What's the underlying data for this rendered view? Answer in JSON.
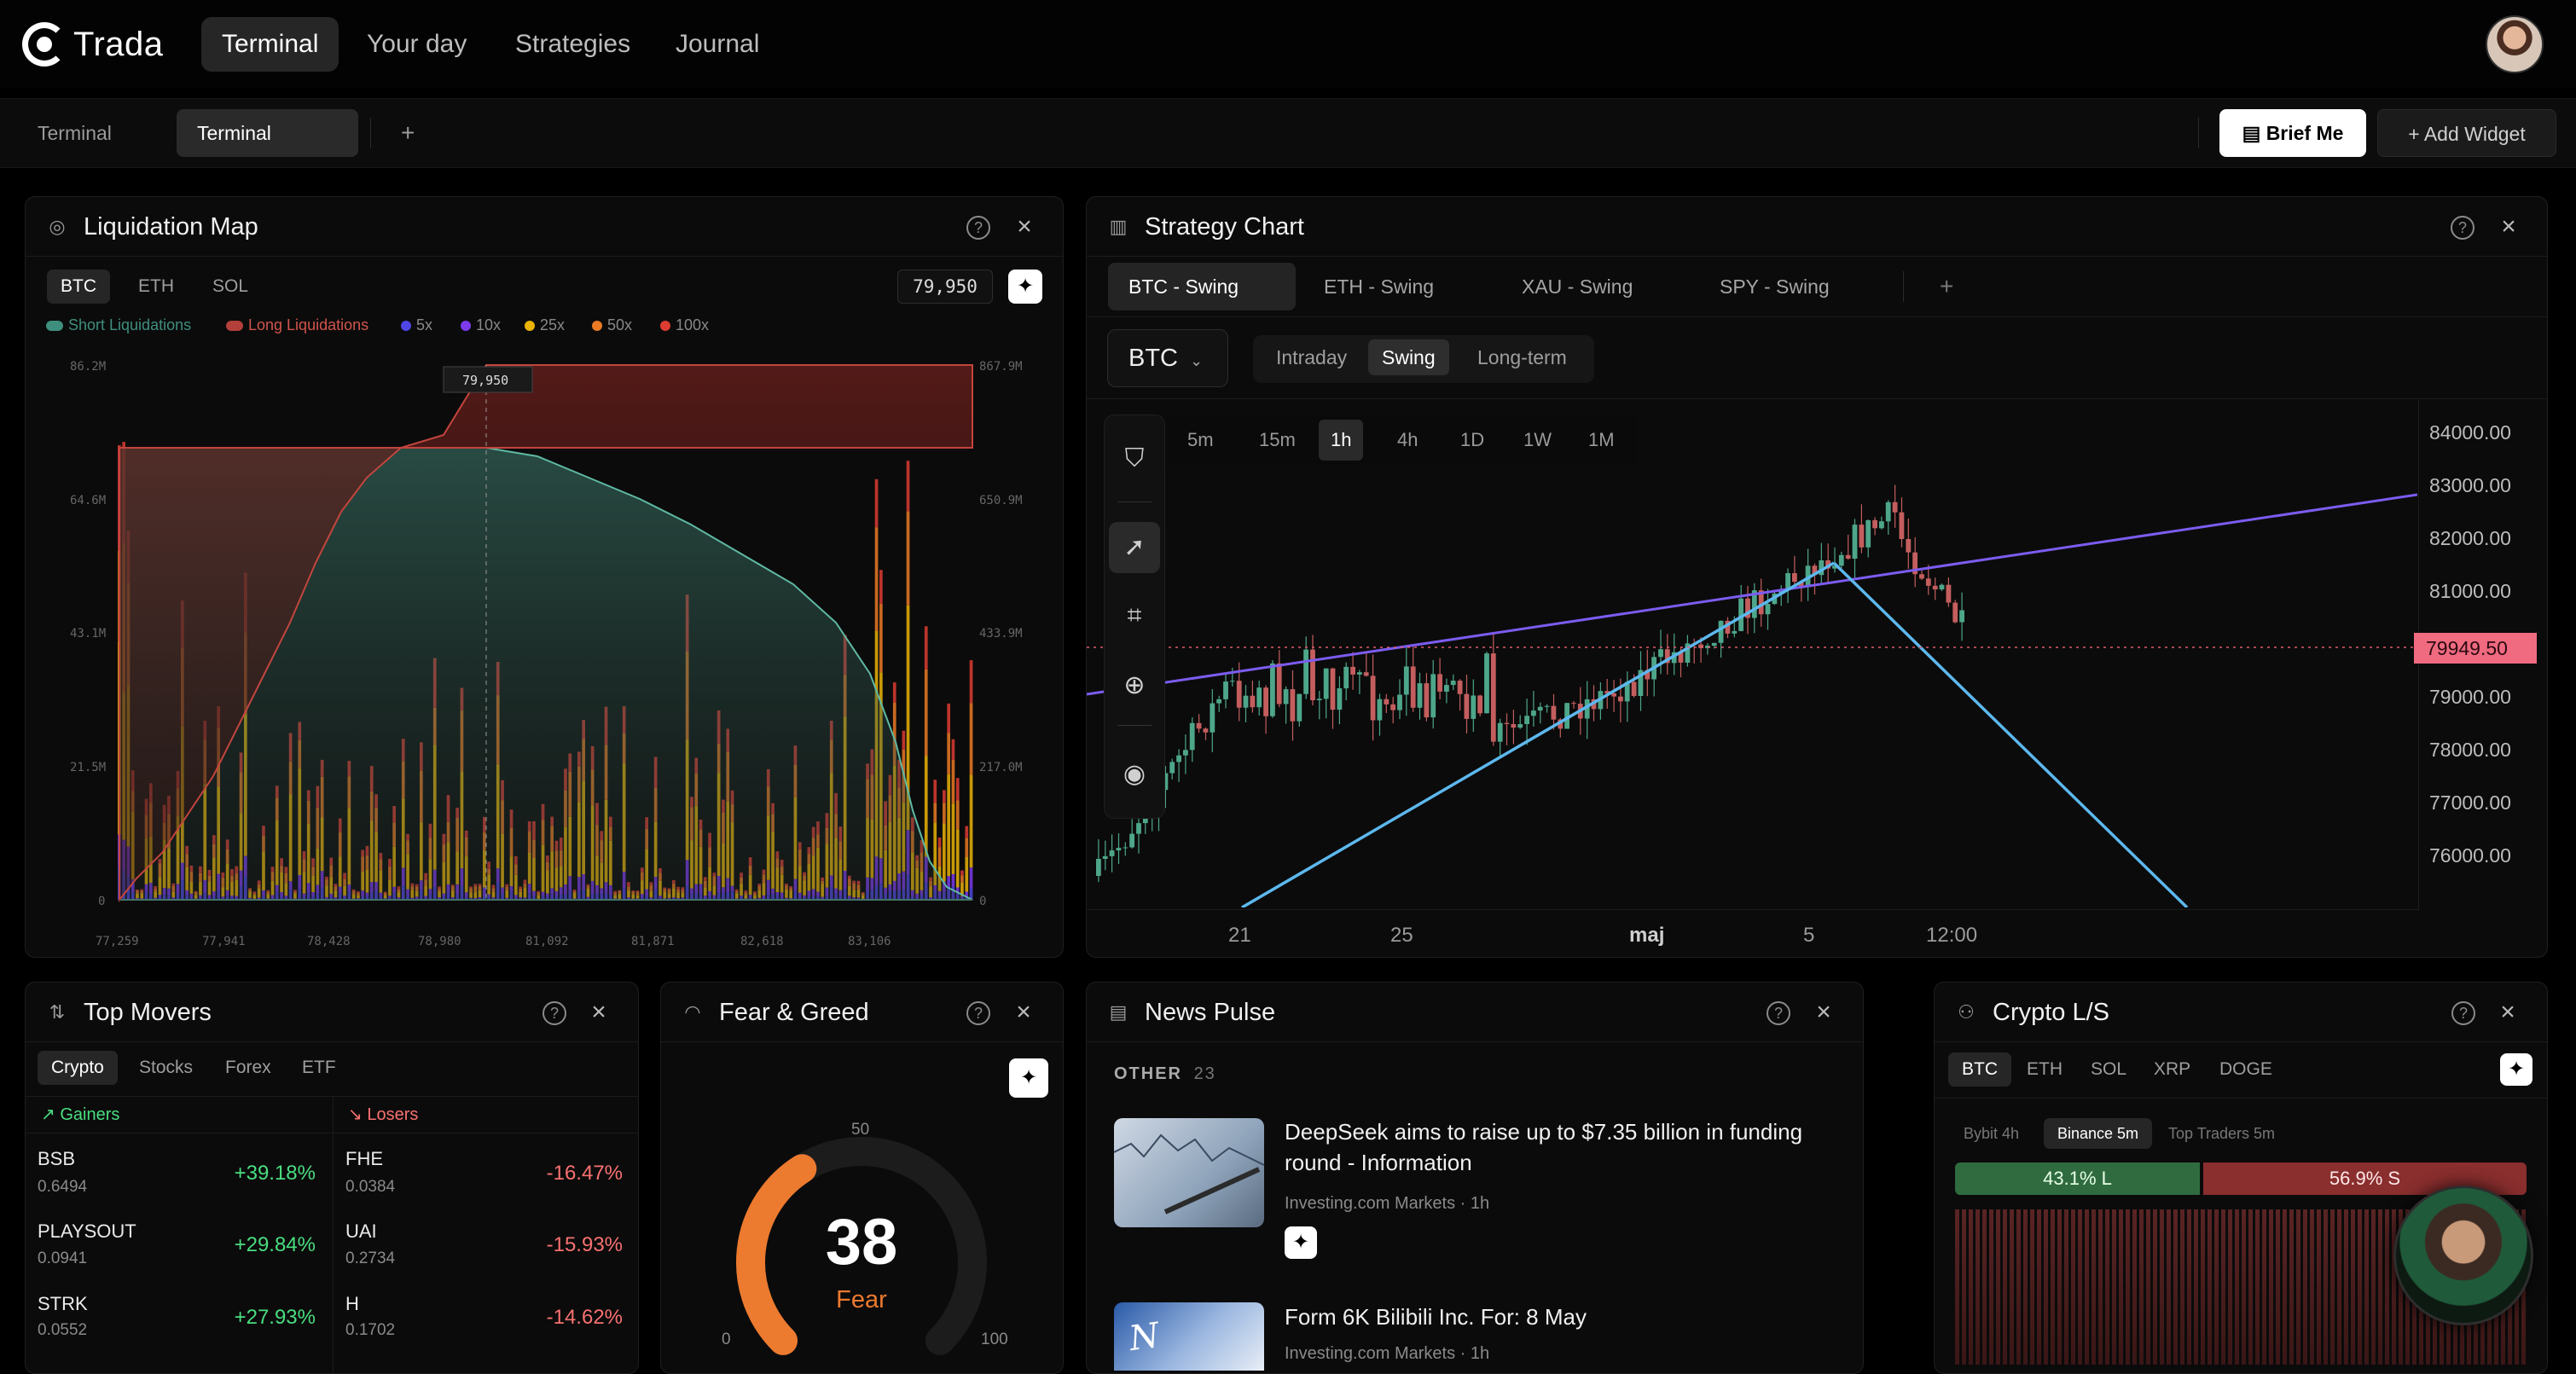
{
  "app": {
    "logo_text": "Trada",
    "nav": [
      "Terminal",
      "Your day",
      "Strategies",
      "Journal"
    ],
    "sub_tabs": [
      "Terminal",
      "Terminal"
    ],
    "add_tab": "+",
    "brief_me": "Brief Me",
    "add_widget": "Add Widget"
  },
  "liquidation": {
    "title": "Liquidation Map",
    "assets": [
      "BTC",
      "ETH",
      "SOL"
    ],
    "price_value": "79,950",
    "legend": [
      "Short Liquidations",
      "Long Liquidations",
      "5x",
      "10x",
      "25x",
      "50x",
      "100x"
    ],
    "legend_colors": [
      "#3f8f7e",
      "#b3403a",
      "#4f46e5",
      "#7c3aed",
      "#eab308",
      "#ea7a24",
      "#dc3c32"
    ],
    "y_left": [
      "86.2M",
      "64.6M",
      "43.1M",
      "21.5M",
      "0"
    ],
    "y_right": [
      "867.9M",
      "650.9M",
      "433.9M",
      "217.0M",
      "0"
    ],
    "x_ticks": [
      "77,259",
      "77,941",
      "78,428",
      "78,980",
      "81,092",
      "81,871",
      "82,618",
      "83,106"
    ],
    "cursor_label": "79,950"
  },
  "strategy": {
    "title": "Strategy Chart",
    "tabs": [
      "BTC - Swing",
      "ETH - Swing",
      "XAU - Swing",
      "SPY - Swing"
    ],
    "add_tab": "+",
    "asset_select": "BTC",
    "modes": [
      "Intraday",
      "Swing",
      "Long-term"
    ],
    "timeframes": [
      "5m",
      "15m",
      "1h",
      "4h",
      "1D",
      "1W",
      "1M"
    ],
    "prices": [
      "84000.00",
      "83000.00",
      "82000.00",
      "81000.00",
      "79000.00",
      "78000.00",
      "77000.00",
      "76000.00"
    ],
    "current_price": "79949.50",
    "x_dates": [
      "21",
      "25",
      "maj",
      "5",
      "12:00"
    ]
  },
  "movers": {
    "title": "Top Movers",
    "tabs": [
      "Crypto",
      "Stocks",
      "Forex",
      "ETF"
    ],
    "gainers_label": "Gainers",
    "losers_label": "Losers",
    "gainers": [
      {
        "name": "BSB",
        "price": "0.6494",
        "pct": "+39.18%"
      },
      {
        "name": "PLAYSOUT",
        "price": "0.0941",
        "pct": "+29.84%"
      },
      {
        "name": "STRK",
        "price": "0.0552",
        "pct": "+27.93%"
      }
    ],
    "losers": [
      {
        "name": "FHE",
        "price": "0.0384",
        "pct": "-16.47%"
      },
      {
        "name": "UAI",
        "price": "0.2734",
        "pct": "-15.93%"
      },
      {
        "name": "H",
        "price": "0.1702",
        "pct": "-14.62%"
      }
    ]
  },
  "fear": {
    "title": "Fear & Greed",
    "value": "38",
    "label": "Fear",
    "scale_min": "0",
    "scale_mid": "50",
    "scale_max": "100",
    "level": 0.38
  },
  "news": {
    "title": "News Pulse",
    "section": "OTHER",
    "count": "23",
    "items": [
      {
        "title_line1": "DeepSeek aims to raise up to $7.35 billion in funding",
        "title_line2": "round - Information",
        "source": "Investing.com Markets · 1h"
      },
      {
        "title_line1": "Form 6K Bilibili Inc. For: 8 May",
        "title_line2": "",
        "source": "Investing.com Markets · 1h"
      }
    ]
  },
  "crypto_ls": {
    "title": "Crypto L/S",
    "assets": [
      "BTC",
      "ETH",
      "SOL",
      "XRP",
      "DOGE"
    ],
    "sources": [
      "Bybit 4h",
      "Binance 5m",
      "Top Traders 5m"
    ],
    "long": "43.1% L",
    "short": "56.9% S",
    "long_share": 0.431
  }
}
